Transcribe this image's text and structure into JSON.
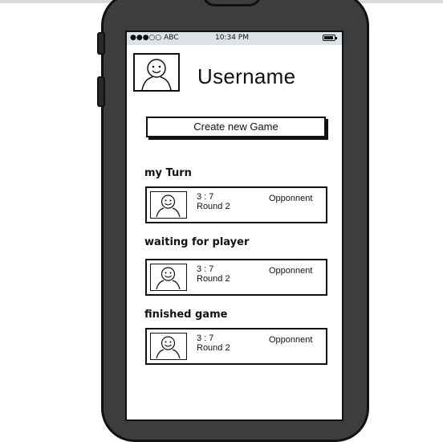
{
  "status_bar": {
    "carrier": "●●●○○ ABC",
    "time": "10:34 PM",
    "battery_icon": "battery-icon"
  },
  "profile": {
    "username": "Username",
    "avatar_icon": "smiley-face-icon"
  },
  "create_button": {
    "label": "Create new Game"
  },
  "sections": [
    {
      "title": "my Turn",
      "game": {
        "score": "3 : 7",
        "round": "Round 2",
        "opponent": "Opponnent"
      }
    },
    {
      "title": "waiting for player",
      "game": {
        "score": "3 : 7",
        "round": "Round 2",
        "opponent": "Opponnent"
      }
    },
    {
      "title": "finished game",
      "game": {
        "score": "3 : 7",
        "round": "Round 2",
        "opponent": "Opponnent"
      }
    }
  ]
}
